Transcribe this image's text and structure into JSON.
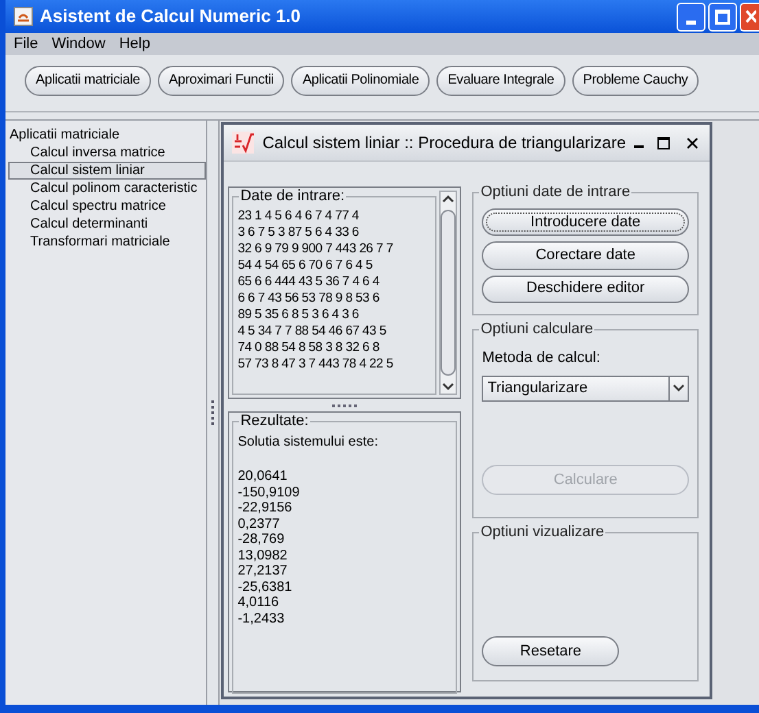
{
  "window": {
    "title": "Asistent de Calcul Numeric 1.0"
  },
  "menu": [
    "File",
    "Window",
    "Help"
  ],
  "toolbar": [
    "Aplicatii matriciale",
    "Aproximari Functii",
    "Aplicatii Polinomiale",
    "Evaluare Integrale",
    "Probleme Cauchy"
  ],
  "tree": {
    "label": "Aplicatii matriciale",
    "children": [
      {
        "label": "Calcul inversa matrice",
        "selected": false
      },
      {
        "label": "Calcul sistem liniar",
        "selected": true
      },
      {
        "label": "Calcul polinom caracteristic",
        "selected": false
      },
      {
        "label": "Calcul spectru matrice",
        "selected": false
      },
      {
        "label": "Calcul determinanti",
        "selected": false
      },
      {
        "label": "Transformari matriciale",
        "selected": false
      }
    ]
  },
  "frame": {
    "title": "Calcul sistem liniar  ::  Procedura de triangularizare",
    "input": {
      "legend": "Date de intrare:",
      "lines": [
        "23 1 4 5 6 4 6 7 4 77 4",
        "3 6 7 5 3 87 5 6 4 33 6",
        "32 6 9 79 9 900 7 443 26 7 7",
        "54 4 54 65 6 70 6 7 6 4 5",
        "65 6 6 444 43 5 36 7 4 6 4",
        "6 6 7 43 56 53 78 9 8 53 6",
        "89 5 35 6 8 5 3 6 4 3 6",
        "4 5 34 7 7 88 54 46 67 43 5",
        "74 0 88 54 8 58 3 8 32 6 8",
        "57 73 8 47 3 7 443 78 4 22 5"
      ]
    },
    "results": {
      "legend": "Rezultate:",
      "heading": "Solutia sistemului este:",
      "values": [
        "20,0641",
        "-150,9109",
        "-22,9156",
        "0,2377",
        "-28,769",
        "13,0982",
        "27,2137",
        "-25,6381",
        "4,0116",
        "-1,2433"
      ]
    },
    "input_options": {
      "legend": "Optiuni date de intrare",
      "buttons": [
        {
          "label": "Introducere date",
          "focused": true
        },
        {
          "label": "Corectare date",
          "focused": false
        },
        {
          "label": "Deschidere editor",
          "focused": false
        }
      ]
    },
    "calc_options": {
      "legend": "Optiuni calculare",
      "method_label": "Metoda de calcul:",
      "method_value": "Triangularizare",
      "button": {
        "label": "Calculare",
        "disabled": true
      }
    },
    "view_options": {
      "legend": "Optiuni vizualizare",
      "button": {
        "label": "Resetare",
        "disabled": false
      }
    }
  }
}
